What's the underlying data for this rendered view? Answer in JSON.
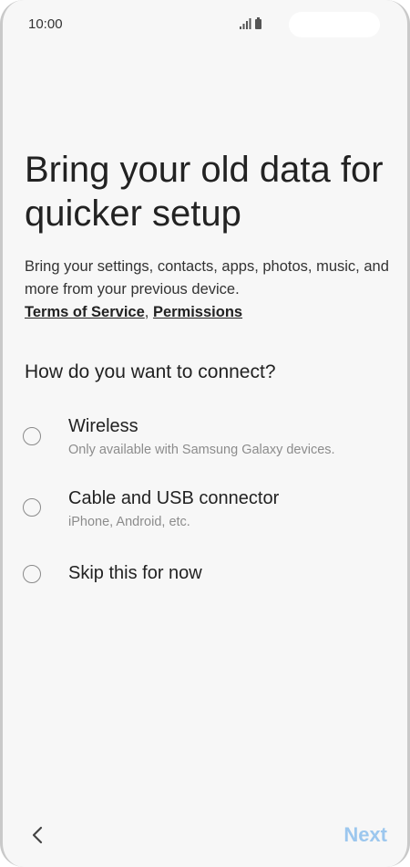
{
  "status_bar": {
    "time": "10:00",
    "icons": [
      "signal-icon",
      "battery-icon"
    ]
  },
  "page": {
    "title": "Bring your old data for quicker setup",
    "description": "Bring your settings, contacts, apps, photos, music, and more from your previous device.",
    "links": {
      "terms": "Terms of Service",
      "separator": ",",
      "permissions": "Permissions"
    },
    "question": "How do you want to connect?"
  },
  "options": [
    {
      "label": "Wireless",
      "sublabel": "Only available with Samsung Galaxy devices.",
      "selected": false
    },
    {
      "label": "Cable and USB connector",
      "sublabel": "iPhone, Android, etc.",
      "selected": false
    },
    {
      "label": "Skip this for now",
      "sublabel": "",
      "selected": false
    }
  ],
  "navigation": {
    "back_icon": "chevron-left-icon",
    "next_label": "Next",
    "next_enabled": false,
    "next_color": "#9cc7ee"
  }
}
